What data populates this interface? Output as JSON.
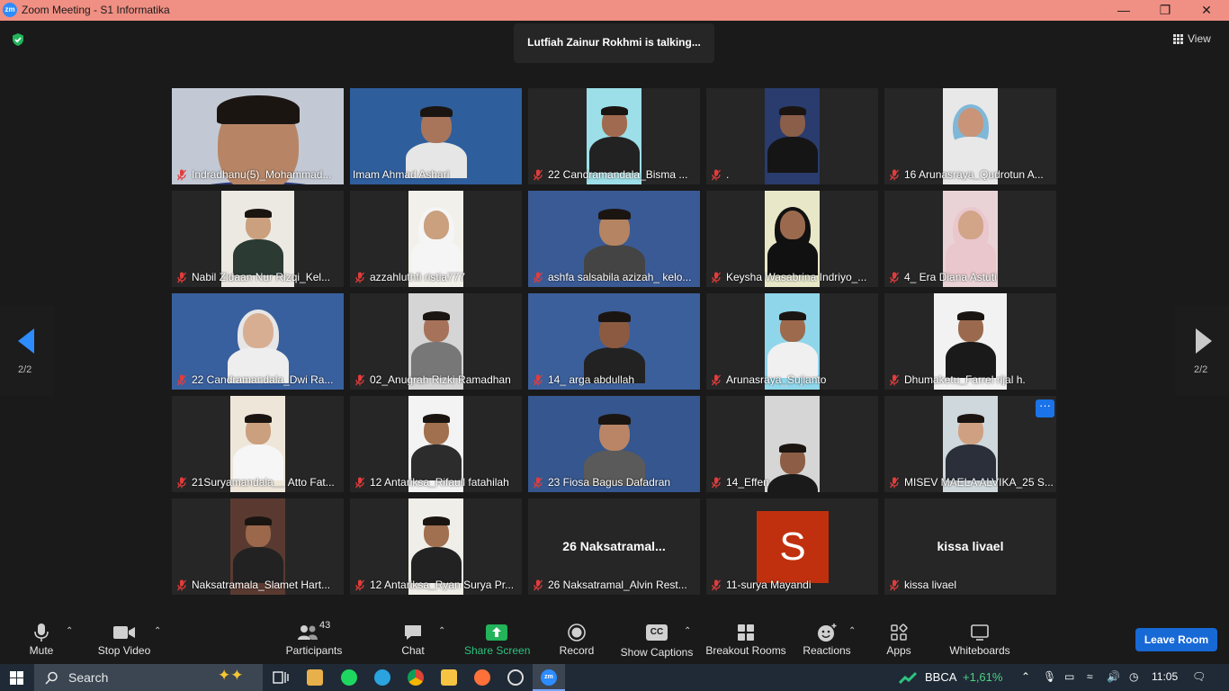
{
  "window": {
    "title": "Zoom Meeting - S1 Informatika",
    "logo_text": "zm"
  },
  "banner": {
    "talking": "Lutfiah Zainur Rokhmi is talking..."
  },
  "view": {
    "label": "View"
  },
  "pagination": {
    "left": "2/2",
    "right": "2/2"
  },
  "tiles": [
    {
      "name": "Indradhanu(5)_Mohammad...",
      "muted": true
    },
    {
      "name": "Imam Ahmad Ashari",
      "muted": false
    },
    {
      "name": "22 Candramandala_Bisma ...",
      "muted": true
    },
    {
      "name": ".",
      "muted": true
    },
    {
      "name": "16 Arunasraya_Qudrotun A...",
      "muted": true
    },
    {
      "name": "Nabil Zidaan Nur Rizqi_Kel...",
      "muted": true
    },
    {
      "name": "azzahluthfi ristia777",
      "muted": true
    },
    {
      "name": "ashfa salsabila azizah_ kelo...",
      "muted": true
    },
    {
      "name": "Keysha Wasabrina Indriyo_...",
      "muted": true
    },
    {
      "name": "4_ Era Diana Astuti",
      "muted": true
    },
    {
      "name": "22 Candramandala_Dwi Ra...",
      "muted": true
    },
    {
      "name": "02_Anugrah Rizki Ramadhan",
      "muted": true
    },
    {
      "name": "14_ arga abdullah",
      "muted": true
    },
    {
      "name": "Arunasraya_Sujianto",
      "muted": true
    },
    {
      "name": "Dhumaketu_Farrel rijal h.",
      "muted": true
    },
    {
      "name": "21Suryamandala__ Atto Fat...",
      "muted": true
    },
    {
      "name": "12 Antariksa_Rifaull fatahilah",
      "muted": true
    },
    {
      "name": "23 Fiosa Bagus Dafadran",
      "muted": true
    },
    {
      "name": "14_Effen",
      "muted": true
    },
    {
      "name": "MISEV MAELA ALVIKA_25 S...",
      "muted": true
    },
    {
      "name": "Naksatramala_Slamet Hart...",
      "muted": true
    },
    {
      "name": "12 Antariksa_Ryan Surya Pr...",
      "muted": true
    },
    {
      "name": "26 Naksatramal_Alvin Rest...",
      "muted": true,
      "big_name": "26  Naksatramal..."
    },
    {
      "name": "11-surya Mayandi",
      "muted": true,
      "avatar_letter": "S"
    },
    {
      "name": "kissa livael",
      "muted": true,
      "big_name": "kissa livael"
    }
  ],
  "more_button": "···",
  "toolbar": {
    "mute": "Mute",
    "stop_video": "Stop Video",
    "participants": "Participants",
    "participants_count": "43",
    "chat": "Chat",
    "share_screen": "Share Screen",
    "record": "Record",
    "show_captions": "Show Captions",
    "captions_icon_text": "CC",
    "breakout_rooms": "Breakout Rooms",
    "reactions": "Reactions",
    "apps": "Apps",
    "whiteboards": "Whiteboards",
    "leave_room": "Leave Room"
  },
  "taskbar": {
    "search": "Search",
    "stock_name": "BBCA",
    "stock_change": "+1,61%",
    "time": "11:05"
  }
}
